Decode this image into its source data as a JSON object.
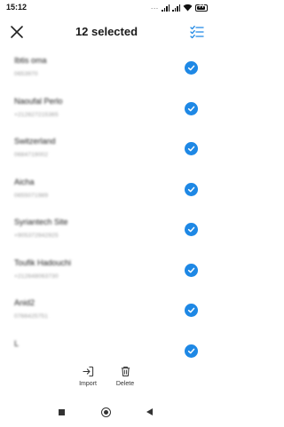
{
  "status_bar": {
    "time": "15:12",
    "dots": "...",
    "battery": "77",
    "icons": [
      "signal-icon",
      "signal-icon",
      "wifi-icon",
      "battery-icon"
    ]
  },
  "header": {
    "title": "12 selected",
    "close_icon": "close-icon",
    "select_all_icon": "checklist-icon"
  },
  "contacts": [
    {
      "name": "Ibtis        oma",
      "phone": "0653970",
      "selected": true
    },
    {
      "name": "Naoufal Perlo",
      "phone": "+212627215365",
      "selected": true
    },
    {
      "name": "Switzerland",
      "phone": "0684719002",
      "selected": true
    },
    {
      "name": "Aicha",
      "phone": "0655071989",
      "selected": true
    },
    {
      "name": "Syriantech Site",
      "phone": "+905372942925",
      "selected": true
    },
    {
      "name": "Toufik Hadouchi",
      "phone": "+212648063730",
      "selected": true
    },
    {
      "name": "Anid2",
      "phone": "0766425751",
      "selected": true
    },
    {
      "name": "L",
      "phone": "",
      "selected": true
    }
  ],
  "actions": {
    "import_label": "Import",
    "delete_label": "Delete"
  },
  "colors": {
    "accent": "#1e88e5",
    "text": "#222222",
    "secondary_text": "#999999"
  }
}
